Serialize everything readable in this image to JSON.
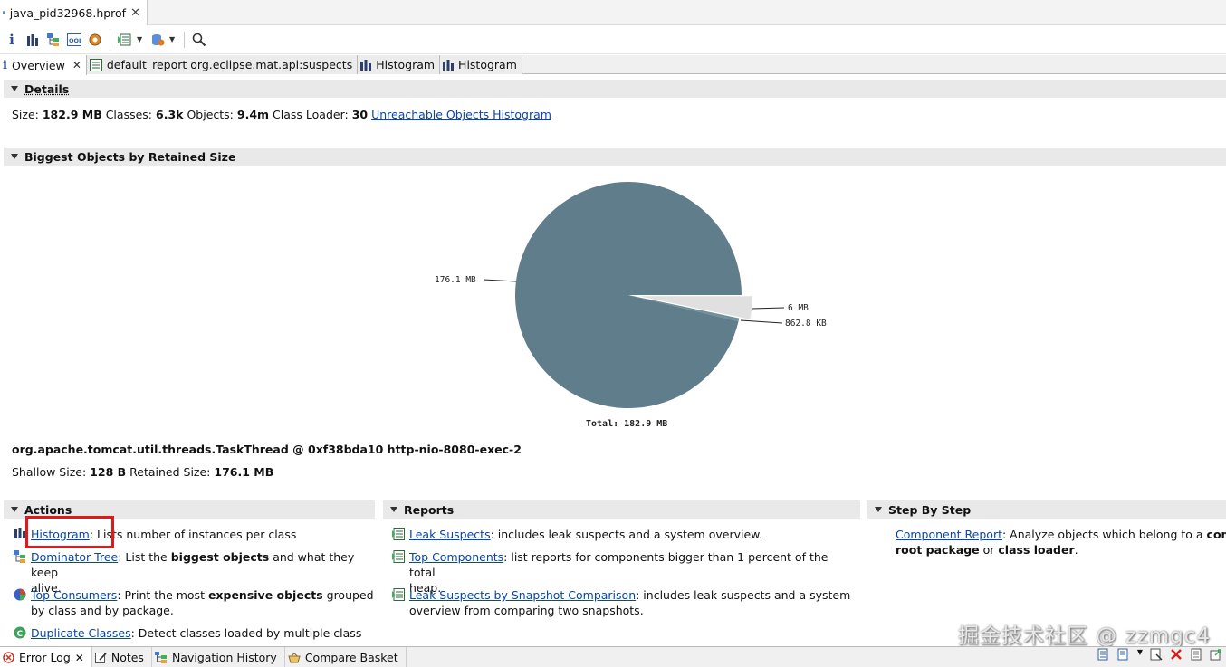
{
  "editor": {
    "tab_title": "java_pid32968.hprof",
    "close": "✕"
  },
  "toolbar": {
    "icons": [
      "info-icon",
      "histogram-icon",
      "dominator-tree-icon",
      "oql-icon",
      "heap-dump-overview-icon",
      "run-report-icon",
      "query-browser-icon",
      "search-icon"
    ]
  },
  "tabs": [
    {
      "label": "Overview",
      "icon": "info-icon",
      "active": true
    },
    {
      "label": "default_report org.eclipse.mat.api:suspects",
      "icon": "report-icon"
    },
    {
      "label": "Histogram",
      "icon": "histogram-icon"
    },
    {
      "label": "Histogram",
      "icon": "histogram-icon"
    }
  ],
  "details": {
    "heading": "Details",
    "size_label": "Size:",
    "size_value": "182.9 MB",
    "classes_label": "Classes:",
    "classes_value": "6.3k",
    "objects_label": "Objects:",
    "objects_value": "9.4m",
    "loader_label": "Class Loader:",
    "loader_value": "30",
    "unreachable_link": "Unreachable Objects Histogram"
  },
  "biggest": {
    "heading": "Biggest Objects by Retained Size",
    "slices": [
      {
        "label": "176.1 MB",
        "value_mb": 176.1,
        "color": "#607d8b"
      },
      {
        "label": "6 MB",
        "value_mb": 6.0,
        "color": "#e0e0e0"
      },
      {
        "label": "862.8 KB",
        "value_mb": 0.84,
        "color": "#6f8f99"
      }
    ],
    "total": "Total: 182.9 MB",
    "object_name": "org.apache.tomcat.util.threads.TaskThread @ 0xf38bda10 http-nio-8080-exec-2",
    "shallow_label": "Shallow Size:",
    "shallow_value": "128 B",
    "retained_label": "Retained Size:",
    "retained_value": "176.1 MB"
  },
  "actions": {
    "heading": "Actions",
    "histogram": {
      "link": "Histogram",
      "rest": ": Lists number of instances per class"
    },
    "dominator": {
      "link": "Dominator Tree",
      "pre": ": List the ",
      "bold": "biggest objects",
      "post": " and what they keep",
      "line2": "alive."
    },
    "consumers": {
      "link": "Top Consumers",
      "pre": ": Print the most ",
      "bold": "expensive objects",
      "post": " grouped",
      "line2": "by class and by package."
    },
    "duplicates": {
      "link": "Duplicate Classes",
      "rest": ": Detect classes loaded by multiple class"
    }
  },
  "reports": {
    "heading": "Reports",
    "leak": {
      "link": "Leak Suspects",
      "rest": ": includes leak suspects and a system overview."
    },
    "components": {
      "link": "Top Components",
      "rest": ": list reports for components bigger than 1 percent of the total",
      "line2": "heap."
    },
    "comparison": {
      "link": "Leak Suspects by Snapshot Comparison",
      "rest": ": includes leak suspects and a system",
      "line2": "overview from comparing two snapshots."
    }
  },
  "step": {
    "heading": "Step By Step",
    "component": {
      "link": "Component Report",
      "rest": ": Analyze objects which belong to a ",
      "bold1": "common",
      "bold2": "root package",
      "mid": " or ",
      "bold3": "class loader",
      "end": "."
    }
  },
  "bottom_tabs": [
    {
      "label": "Error Log",
      "icon": "error-log-icon",
      "close": "✕"
    },
    {
      "label": "Notes",
      "icon": "notes-icon"
    },
    {
      "label": "Navigation History",
      "icon": "navigation-history-icon"
    },
    {
      "label": "Compare Basket",
      "icon": "compare-basket-icon"
    }
  ],
  "watermark": "掘金技术社区 @ zzmgc4",
  "colors": {
    "link": "#0645ad",
    "section_bg": "#e9e9e9",
    "highlight": "#e0191b"
  }
}
